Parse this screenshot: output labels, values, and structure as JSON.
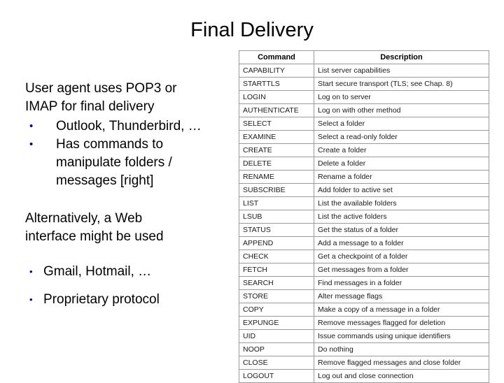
{
  "slide": {
    "title": "Final Delivery",
    "accent_bullet_color": "#000080",
    "text_color": "#000000"
  },
  "left_content": {
    "paragraph1": {
      "line1": "User agent uses POP3 or",
      "line2": "IMAP for final delivery"
    },
    "bullets1": [
      {
        "text": "Outlook, Thunderbird, …"
      },
      {
        "text": "Has commands to"
      },
      {
        "text": "manipulate folders /"
      },
      {
        "text": "messages [right]"
      }
    ],
    "paragraph2": {
      "line1": "Alternatively, a Web",
      "line2": "interface might be used"
    },
    "bullets2": [
      {
        "text": "Gmail, Hotmail, …"
      },
      {
        "text": "Proprietary protocol"
      }
    ],
    "bullet_glyph": "•"
  },
  "table": {
    "columns": [
      "Command",
      "Description"
    ],
    "rows": [
      {
        "command": "CAPABILITY",
        "description": "List server capabilities"
      },
      {
        "command": "STARTTLS",
        "description": "Start secure transport (TLS; see Chap. 8)"
      },
      {
        "command": "LOGIN",
        "description": "Log on to server"
      },
      {
        "command": "AUTHENTICATE",
        "description": "Log on with other method"
      },
      {
        "command": "SELECT",
        "description": "Select a folder"
      },
      {
        "command": "EXAMINE",
        "description": "Select a read-only folder"
      },
      {
        "command": "CREATE",
        "description": "Create a folder"
      },
      {
        "command": "DELETE",
        "description": "Delete a folder"
      },
      {
        "command": "RENAME",
        "description": "Rename a folder"
      },
      {
        "command": "SUBSCRIBE",
        "description": "Add folder to active set"
      },
      {
        "command": "LIST",
        "description": "List the available folders"
      },
      {
        "command": "LSUB",
        "description": "List the active folders"
      },
      {
        "command": "STATUS",
        "description": "Get the status of a folder"
      },
      {
        "command": "APPEND",
        "description": "Add a message to a folder"
      },
      {
        "command": "CHECK",
        "description": "Get a checkpoint of a folder"
      },
      {
        "command": "FETCH",
        "description": "Get messages from a folder"
      },
      {
        "command": "SEARCH",
        "description": "Find messages in a folder"
      },
      {
        "command": "STORE",
        "description": "Alter message flags"
      },
      {
        "command": "COPY",
        "description": "Make a copy of a message in a folder"
      },
      {
        "command": "EXPUNGE",
        "description": "Remove messages flagged for deletion"
      },
      {
        "command": "UID",
        "description": "Issue commands using unique identifiers"
      },
      {
        "command": "NOOP",
        "description": "Do nothing"
      },
      {
        "command": "CLOSE",
        "description": "Remove flagged messages and close folder"
      },
      {
        "command": "LOGOUT",
        "description": "Log out and close connection"
      }
    ]
  }
}
